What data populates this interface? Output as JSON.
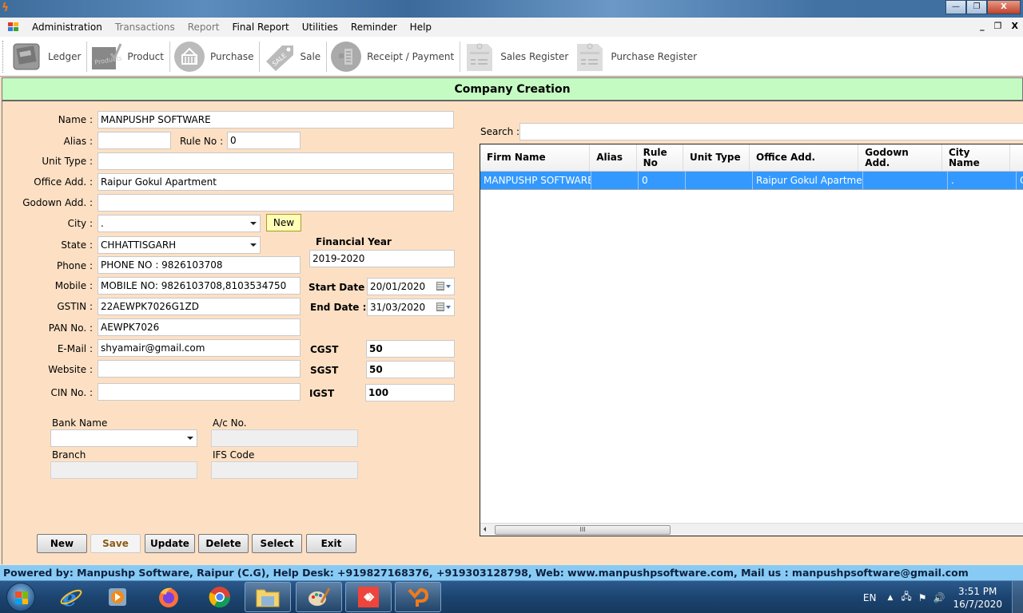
{
  "window": {
    "title": "",
    "controls": {
      "minimize": "—",
      "restore": "❐",
      "close": "X"
    }
  },
  "menu": {
    "items": [
      {
        "label": "Administration",
        "enabled": true
      },
      {
        "label": "Transactions",
        "enabled": false
      },
      {
        "label": "Report",
        "enabled": false
      },
      {
        "label": "Final Report",
        "enabled": true
      },
      {
        "label": "Utilities",
        "enabled": true
      },
      {
        "label": "Reminder",
        "enabled": true
      },
      {
        "label": "Help",
        "enabled": true
      }
    ],
    "mdi_controls": {
      "minimize": "_",
      "restore": "🗗",
      "close": "X"
    }
  },
  "toolbar": {
    "items": [
      {
        "label": "Ledger",
        "icon": "ledger-book-icon"
      },
      {
        "label": "Product",
        "icon": "products-box-icon"
      },
      {
        "label": "Purchase",
        "icon": "shopping-basket-icon"
      },
      {
        "label": "Sale",
        "icon": "sale-tag-icon"
      },
      {
        "label": "Receipt / Payment",
        "icon": "receipt-icon"
      },
      {
        "label": "Sales Register",
        "icon": "register-clipboard-icon"
      },
      {
        "label": "Purchase Register",
        "icon": "register-clipboard-icon"
      }
    ]
  },
  "form": {
    "title": "Company Creation",
    "fields": {
      "name": {
        "label": "Name :",
        "value": "MANPUSHP SOFTWARE"
      },
      "alias": {
        "label": "Alias :",
        "value": ""
      },
      "rule_no": {
        "label": "Rule No :",
        "value": "0"
      },
      "unit_type": {
        "label": "Unit Type :",
        "value": ""
      },
      "office_add": {
        "label": "Office Add. :",
        "value": "Raipur Gokul Apartment"
      },
      "godown_add": {
        "label": "Godown Add. :",
        "value": ""
      },
      "city": {
        "label": "City :",
        "value": "."
      },
      "city_new": "New",
      "state": {
        "label": "State :",
        "value": "CHHATTISGARH"
      },
      "phone": {
        "label": "Phone :",
        "value": "PHONE NO : 9826103708"
      },
      "mobile": {
        "label": "Mobile :",
        "value": "MOBILE NO: 9826103708,8103534750"
      },
      "gstin": {
        "label": "GSTIN :",
        "value": "22AEWPK7026G1ZD"
      },
      "pan": {
        "label": "PAN No. :",
        "value": "AEWPK7026"
      },
      "email": {
        "label": "E-Mail :",
        "value": "shyamair@gmail.com"
      },
      "website": {
        "label": "Website :",
        "value": ""
      },
      "cin": {
        "label": "CIN No. :",
        "value": ""
      },
      "financial_year": {
        "label": "Financial Year",
        "value": "2019-2020"
      },
      "start_date": {
        "label": "Start Date :",
        "value": "20/01/2020"
      },
      "end_date": {
        "label": "End Date :",
        "value": "31/03/2020"
      },
      "cgst": {
        "label": "CGST",
        "value": "50"
      },
      "sgst": {
        "label": "SGST",
        "value": "50"
      },
      "igst": {
        "label": "IGST",
        "value": "100"
      },
      "bank_name": {
        "label": "Bank Name",
        "value": ""
      },
      "ac_no": {
        "label": "A/c No.",
        "value": ""
      },
      "branch": {
        "label": "Branch",
        "value": ""
      },
      "ifs_code": {
        "label": "IFS Code",
        "value": ""
      }
    },
    "buttons": {
      "new": "New",
      "save": "Save",
      "update": "Update",
      "delete": "Delete",
      "select": "Select",
      "exit": "Exit"
    }
  },
  "search": {
    "label": "Search :",
    "value": ""
  },
  "grid": {
    "columns": [
      "Firm Name",
      "Alias",
      "Rule No",
      "Unit Type",
      "Office Add.",
      "Godown Add.",
      "City Name"
    ],
    "rows": [
      {
        "firm_name": "MANPUSHP SOFTWARE",
        "alias": "",
        "rule_no": "0",
        "unit_type": "",
        "office_add": "Raipur Gokul Apartment",
        "godown_add": "",
        "city_name": ".",
        "overflow": "C"
      }
    ],
    "hscroll_grip": "III"
  },
  "footer": {
    "text": "Powered by: Manpushp Software, Raipur (C.G), Help Desk: +919827168376, +919303128798, Web: www.manpushpsoftware.com,  Mail us :  manpushpsoftware@gmail.com"
  },
  "taskbar": {
    "language": "EN",
    "time": "3:51 PM",
    "date": "16/7/2020",
    "apps": [
      "internet-explorer",
      "media-player",
      "firefox",
      "chrome",
      "file-explorer",
      "paint",
      "anydesk",
      "manpushp"
    ]
  },
  "colors": {
    "form_bg": "#fde0c4",
    "header_bg": "#c4fbc2",
    "selection": "#3399ff",
    "footer_bg": "#87cbf5",
    "new_btn_bg": "#ffffb8"
  }
}
